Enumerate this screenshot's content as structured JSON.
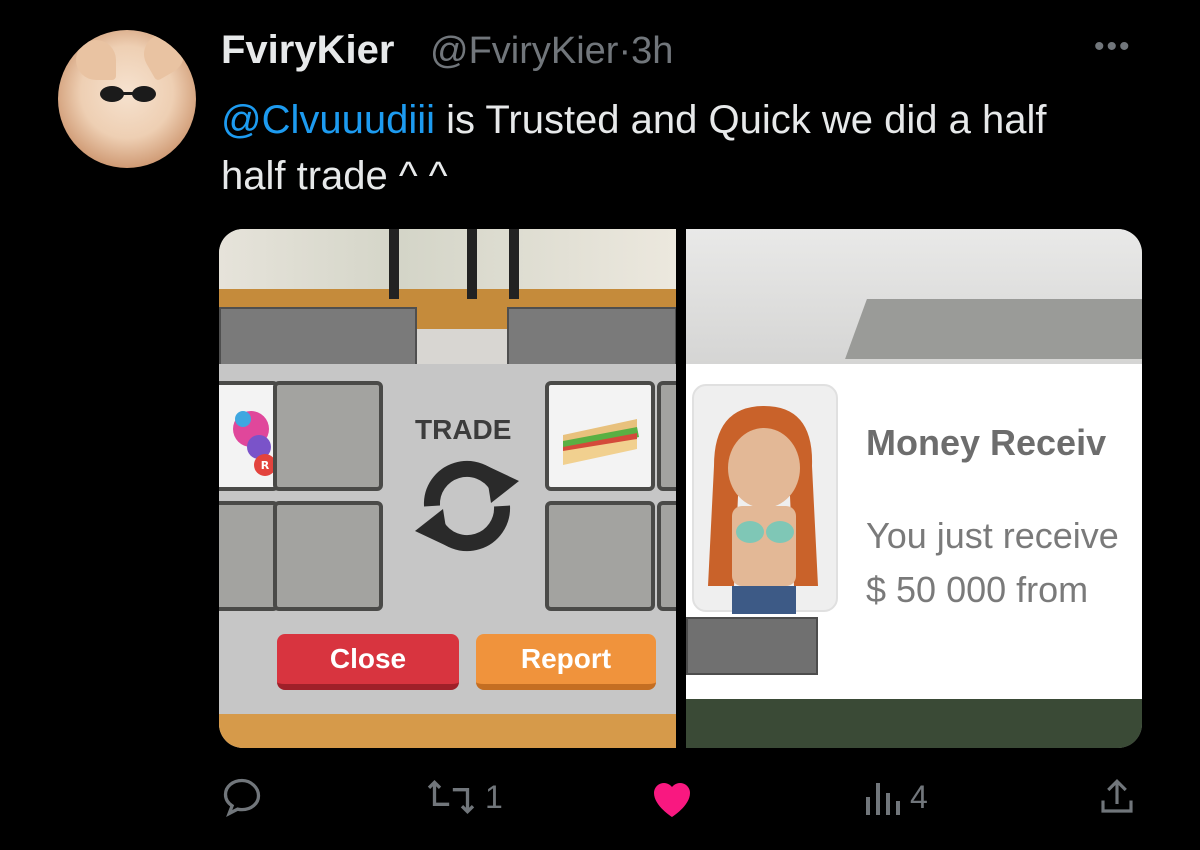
{
  "tweet": {
    "author_name": "FviryKier",
    "author_handle": "@FviryKier",
    "separator": "·",
    "time": "3h",
    "mention": "@Clvuuudiii",
    "text_rest": " is Trusted and Quick we did a half half trade ^ ^",
    "more_label": "•••"
  },
  "media": {
    "left": {
      "trade_label": "TRADE",
      "close_label": "Close",
      "report_label": "Report",
      "badge_letter": "R"
    },
    "right": {
      "title": "Money Receiv",
      "line1": "You just receive",
      "line2": "$ 50 000 from"
    }
  },
  "actions": {
    "reply_icon": "reply-icon",
    "retweet_count": "1",
    "like_icon": "heart-icon",
    "like_color": "#f91880",
    "views_count": "4",
    "share_icon": "share-icon"
  },
  "colors": {
    "background": "#000000",
    "mention": "#1d9bf0",
    "muted": "#71767b"
  }
}
